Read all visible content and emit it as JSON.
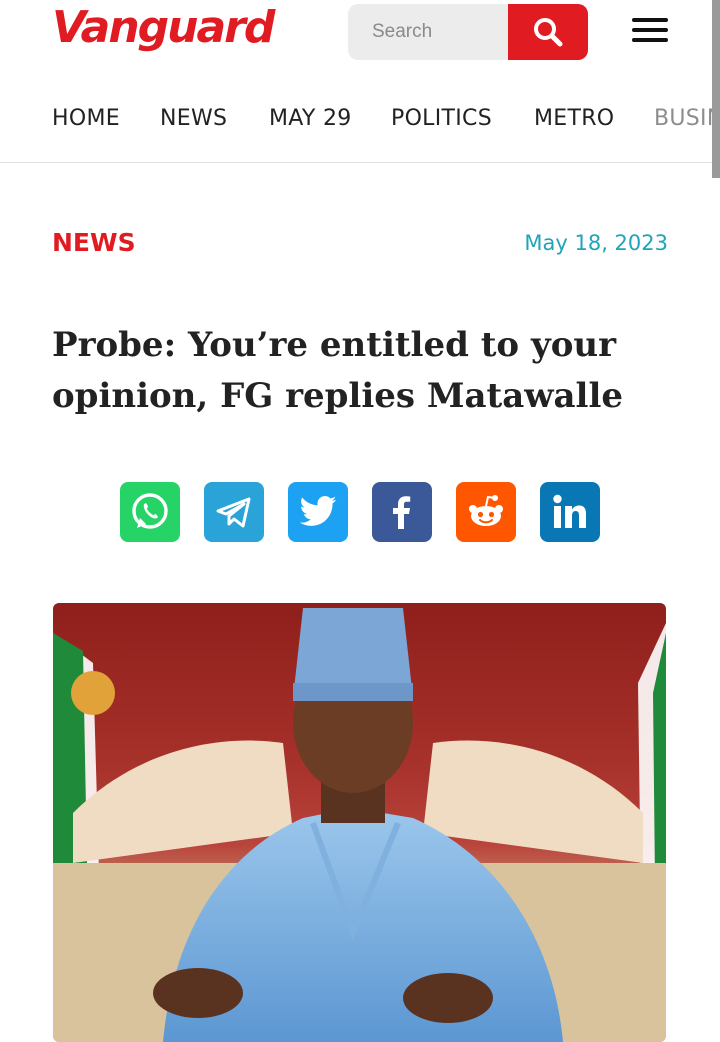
{
  "header": {
    "logo": "Vanguard",
    "search": {
      "placeholder": "Search",
      "value": ""
    },
    "icons": {
      "search": "search-icon",
      "menu": "hamburger-menu-icon"
    }
  },
  "nav": {
    "items": [
      {
        "label": "HOME"
      },
      {
        "label": "NEWS"
      },
      {
        "label": "MAY 29"
      },
      {
        "label": "POLITICS"
      },
      {
        "label": "METRO"
      },
      {
        "label": "BUSIN"
      }
    ]
  },
  "article": {
    "category": "NEWS",
    "date": "May 18, 2023",
    "headline": "Probe: You’re entitled to your opinion, FG replies Matawalle"
  },
  "share": [
    {
      "name": "whatsapp-icon",
      "color": "#25D366"
    },
    {
      "name": "telegram-icon",
      "color": "#2AA3D9"
    },
    {
      "name": "twitter-icon",
      "color": "#1DA1F2"
    },
    {
      "name": "facebook-icon",
      "color": "#3B5998"
    },
    {
      "name": "reddit-icon",
      "color": "#FF5700"
    },
    {
      "name": "linkedin-icon",
      "color": "#0A77B5"
    }
  ],
  "colors": {
    "brand": "#e11b22",
    "date": "#22a3b8"
  }
}
